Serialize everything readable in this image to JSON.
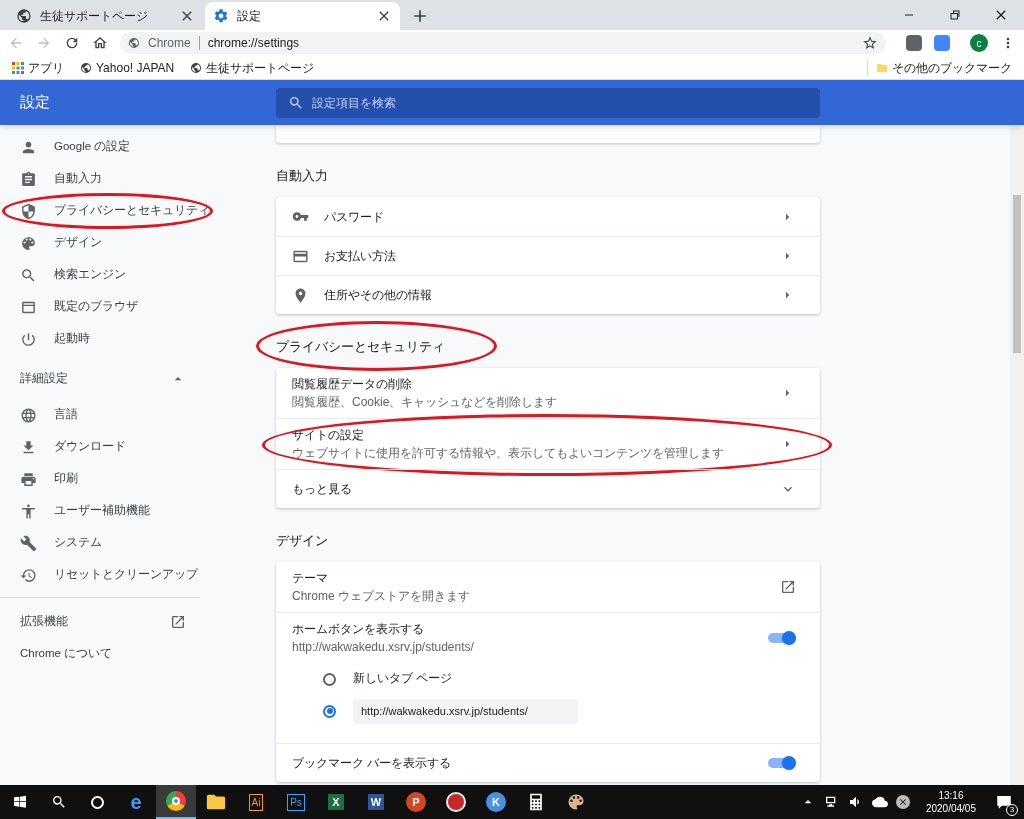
{
  "browser": {
    "tabs": [
      {
        "title": "生徒サポートページ",
        "selected": false
      },
      {
        "title": "設定",
        "selected": true
      }
    ],
    "address": {
      "scheme": "Chrome",
      "url": "chrome://settings"
    },
    "profile_initial": "c",
    "bookmarks": [
      {
        "label": "アプリ",
        "kind": "apps"
      },
      {
        "label": "Yahoo! JAPAN",
        "kind": "site"
      },
      {
        "label": "生徒サポートページ",
        "kind": "site"
      }
    ],
    "other_bookmarks": "その他のブックマーク"
  },
  "header": {
    "title": "設定",
    "search_placeholder": "設定項目を検索"
  },
  "sidebar": {
    "items": [
      {
        "label": "Google の設定",
        "circled": false
      },
      {
        "label": "自動入力",
        "circled": false
      },
      {
        "label": "プライバシーとセキュリティ",
        "circled": true
      },
      {
        "label": "デザイン",
        "circled": false
      },
      {
        "label": "検索エンジン",
        "circled": false
      },
      {
        "label": "既定のブラウザ",
        "circled": false
      },
      {
        "label": "起動時",
        "circled": false
      }
    ],
    "advanced": {
      "label": "詳細設定",
      "expanded": true,
      "items": [
        {
          "label": "言語"
        },
        {
          "label": "ダウンロード"
        },
        {
          "label": "印刷"
        },
        {
          "label": "ユーザー補助機能"
        },
        {
          "label": "システム"
        },
        {
          "label": "リセットとクリーンアップ"
        }
      ]
    },
    "extensions": "拡張機能",
    "about": "Chrome について"
  },
  "sections": [
    {
      "heading": "自動入力",
      "circled": false,
      "rows": [
        {
          "kind": "link",
          "label": "パスワード",
          "circled": false
        },
        {
          "kind": "link",
          "label": "お支払い方法",
          "circled": false
        },
        {
          "kind": "link",
          "label": "住所やその他の情報",
          "circled": false
        }
      ]
    },
    {
      "heading": "プライバシーとセキュリティ",
      "circled": true,
      "rows": [
        {
          "kind": "link",
          "label": "閲覧履歴データの削除",
          "sub": "閲覧履歴、Cookie、キャッシュなどを削除します",
          "circled": false
        },
        {
          "kind": "link",
          "label": "サイトの設定",
          "sub": "ウェブサイトに使用を許可する情報や、表示してもよいコンテンツを管理します",
          "circled": true
        },
        {
          "kind": "expand",
          "label": "もっと見る",
          "expanded": false,
          "circled": false
        }
      ]
    },
    {
      "heading": "デザイン",
      "circled": false,
      "rows": [
        {
          "kind": "external",
          "label": "テーマ",
          "sub": "Chrome ウェブストアを開きます",
          "circled": false
        },
        {
          "kind": "toggle",
          "label": "ホームボタンを表示する",
          "sub": "http://wakwakedu.xsrv.jp/students/",
          "on": true,
          "circled": false,
          "options": [
            {
              "kind": "text",
              "label": "新しいタブ ページ",
              "selected": false
            },
            {
              "kind": "field",
              "value": "http://wakwakedu.xsrv.jp/students/",
              "selected": true
            }
          ]
        },
        {
          "kind": "toggle",
          "label": "ブックマーク バーを表示する",
          "on": true,
          "circled": false
        }
      ]
    }
  ],
  "taskbar": {
    "apps": [
      {
        "kind": "edge",
        "glyph": "e",
        "running": false
      },
      {
        "kind": "chrome",
        "running": true
      },
      {
        "kind": "folder",
        "running": false
      },
      {
        "kind": "ai",
        "glyph": "Ai",
        "running": false
      },
      {
        "kind": "ps",
        "glyph": "Ps",
        "running": false
      },
      {
        "kind": "excel",
        "glyph": "X",
        "running": false
      },
      {
        "kind": "word",
        "glyph": "W",
        "running": false
      },
      {
        "kind": "ppt",
        "glyph": "P",
        "running": false
      },
      {
        "kind": "mask",
        "running": false
      },
      {
        "kind": "k",
        "glyph": "K",
        "running": false
      },
      {
        "kind": "calc",
        "running": false
      },
      {
        "kind": "paint",
        "running": false
      }
    ],
    "time": "13:16",
    "date": "2020/04/05",
    "notifications": "3"
  }
}
